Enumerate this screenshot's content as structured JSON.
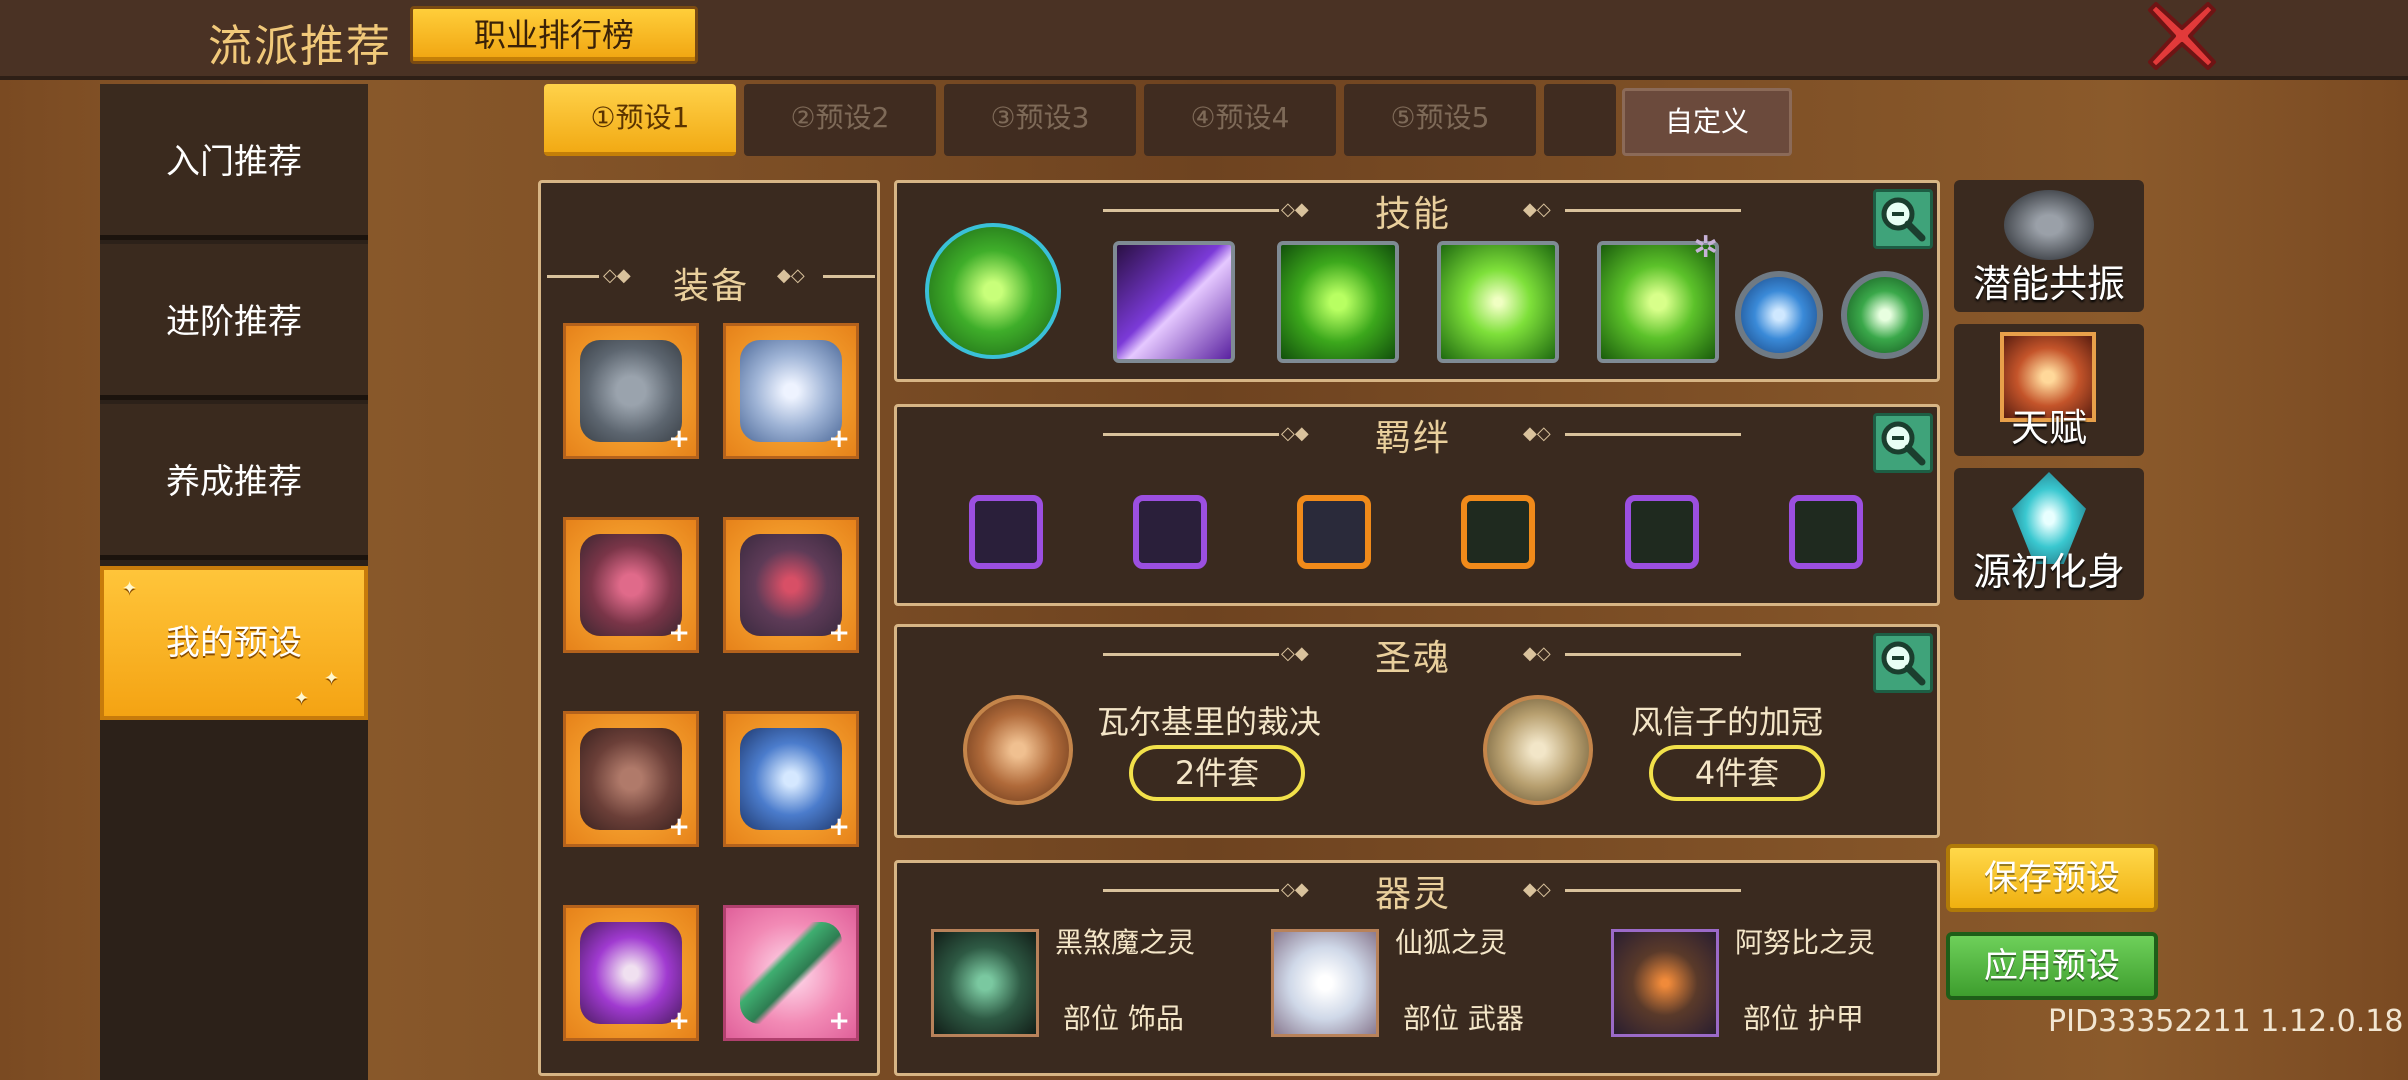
{
  "header": {
    "title": "流派推荐",
    "rank_button": "职业排行榜"
  },
  "sidebar": {
    "items": [
      {
        "label": "入门推荐"
      },
      {
        "label": "进阶推荐"
      },
      {
        "label": "养成推荐"
      },
      {
        "label": "我的预设"
      }
    ]
  },
  "tabs": [
    {
      "label": "①预设1"
    },
    {
      "label": "②预设2"
    },
    {
      "label": "③预设3"
    },
    {
      "label": "④预设4"
    },
    {
      "label": "⑤预设5"
    },
    {
      "label": "自定义"
    }
  ],
  "equipment": {
    "title": "装备"
  },
  "skills": {
    "title": "技能"
  },
  "bonds": {
    "title": "羁绊"
  },
  "holy_souls": {
    "title": "圣魂",
    "items": [
      {
        "name": "瓦尔基里的裁决",
        "set": "2件套"
      },
      {
        "name": "风信子的加冠",
        "set": "4件套"
      }
    ]
  },
  "spirits": {
    "title": "器灵",
    "items": [
      {
        "name": "黑煞魔之灵",
        "slot": "部位 饰品"
      },
      {
        "name": "仙狐之灵",
        "slot": "部位 武器"
      },
      {
        "name": "阿努比之灵",
        "slot": "部位 护甲"
      }
    ]
  },
  "right_menu": {
    "items": [
      {
        "label": "潜能共振"
      },
      {
        "label": "天赋"
      },
      {
        "label": "源初化身"
      }
    ]
  },
  "actions": {
    "save": "保存预设",
    "apply": "应用预设"
  },
  "version": "PID33352211 1.12.0.18",
  "colors": {
    "accent_gold": "#f4a313",
    "save_yellow": "#f5c21c",
    "apply_green": "#4caf3e",
    "close_red": "#e23a3a"
  }
}
